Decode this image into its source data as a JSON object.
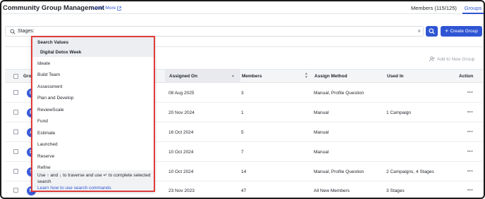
{
  "header": {
    "title": "Community Group Management",
    "learn_more": "Learn More",
    "tabs": [
      {
        "label": "Members (115/125)",
        "active": false
      },
      {
        "label": "Groups",
        "active": true
      }
    ]
  },
  "search": {
    "value": "Stages:",
    "search_icon": "search-icon",
    "clear_icon": "close-icon",
    "clear_glyph": "×"
  },
  "create_button": {
    "label": "Create Group",
    "icon": "plus-icon",
    "glyph": "+"
  },
  "add_to_new_group": {
    "label": "Add to New Group",
    "icon": "add-user-icon"
  },
  "table": {
    "columns": [
      {
        "label": "Grou"
      },
      {
        "label": "Assigned On",
        "sorted": true
      },
      {
        "label": "Members",
        "sortable": true
      },
      {
        "label": "Assign Method"
      },
      {
        "label": "Used In"
      },
      {
        "label": "Action"
      }
    ],
    "rows": [
      {
        "initial": "G",
        "assigned_on": "08 Aug 2025",
        "members": "3",
        "assign_method": "Manual, Profile Question",
        "used_in": ""
      },
      {
        "initial": "P",
        "assigned_on": "20 Nov 2024",
        "members": "1",
        "assign_method": "Manual",
        "used_in": "1 Campaign"
      },
      {
        "initial": "A",
        "assigned_on": "16 Oct 2024",
        "members": "5",
        "assign_method": "Manual",
        "used_in": ""
      },
      {
        "initial": "D",
        "assigned_on": "10 Oct 2024",
        "members": "7",
        "assign_method": "Manual",
        "used_in": ""
      },
      {
        "initial": "S",
        "assigned_on": "10 Oct 2024",
        "members": "14",
        "assign_method": "Manual, Profile Question",
        "used_in": "2 Campaigns, 4 Stages"
      },
      {
        "initial": "M",
        "assigned_on": "23 Nov 2023",
        "members": "47",
        "assign_method": "All New Members",
        "used_in": "3 Stages"
      }
    ],
    "action_glyph": "⋮"
  },
  "dropdown": {
    "heading": "Search Values",
    "selected": "Digital Detox Week",
    "items": [
      "Ideate",
      "Build Team",
      "Assessment",
      "Plan and Develop",
      "ReviewScale",
      "Fund",
      "Estimate",
      "Launched",
      "Reserve",
      "Refine"
    ],
    "hint": "Use ↑ and ↓ to traverse and use ↵ to complete selected search",
    "help_link": "Learn how to use search commands"
  },
  "colors": {
    "accent": "#2f55d4",
    "highlight_border": "#e03c3c",
    "avatar": "#3a5bd9"
  }
}
